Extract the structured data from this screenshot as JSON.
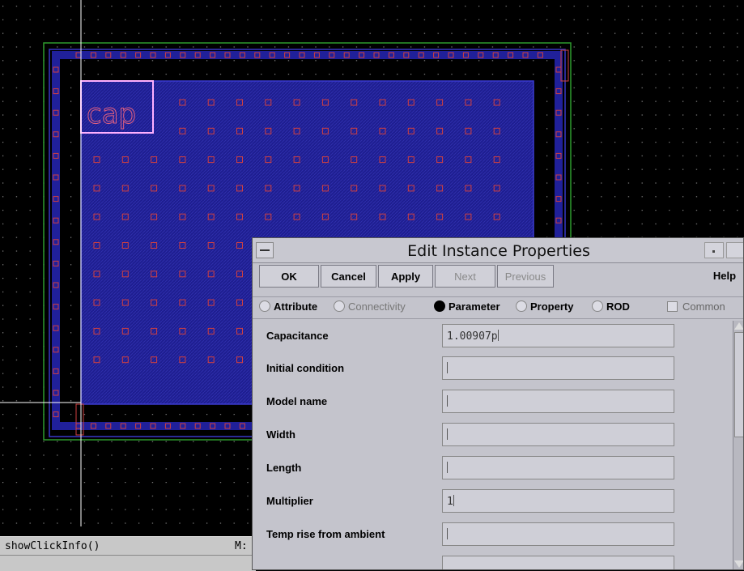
{
  "layout_canvas": {
    "instance_label": "cap"
  },
  "status": {
    "command": "showClickInfo()",
    "mouse_label": "M:"
  },
  "dialog": {
    "title": "Edit Instance Properties",
    "buttons": {
      "ok": "OK",
      "cancel": "Cancel",
      "apply": "Apply",
      "next": "Next",
      "previous": "Previous",
      "help": "Help"
    },
    "tabs": {
      "attribute": "Attribute",
      "connectivity": "Connectivity",
      "parameter": "Parameter",
      "property": "Property",
      "rod": "ROD",
      "selected": "Parameter"
    },
    "common_label": "Common",
    "fields": [
      {
        "label": "Capacitance",
        "value": "1.00907p"
      },
      {
        "label": "Initial condition",
        "value": ""
      },
      {
        "label": "Model name",
        "value": ""
      },
      {
        "label": "Width",
        "value": ""
      },
      {
        "label": "Length",
        "value": ""
      },
      {
        "label": "Multiplier",
        "value": "1"
      },
      {
        "label": "Temp rise from ambient",
        "value": ""
      }
    ]
  },
  "colors": {
    "background": "#000000",
    "well_fill": "#1a1a8c",
    "guard_ring": "#2a8a2a",
    "contact": "#d04040",
    "highlight": "#ffb0ff",
    "dialog_bg": "#c4c4cc"
  }
}
